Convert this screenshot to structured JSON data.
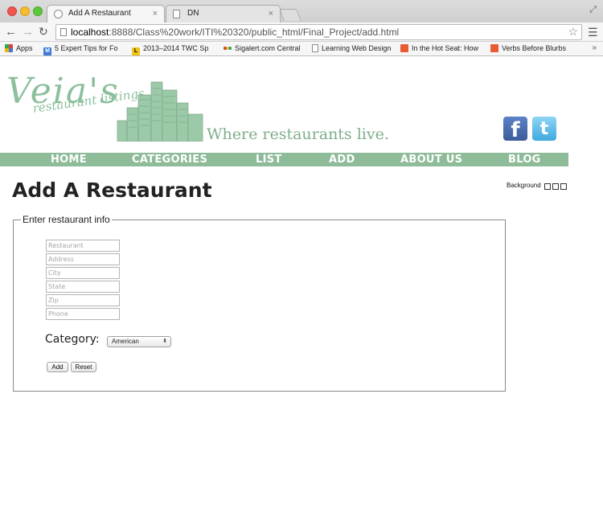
{
  "browser": {
    "tabs": [
      {
        "title": "Add A Restaurant"
      },
      {
        "title": "DN"
      }
    ],
    "close_glyph": "×",
    "url_host": "localhost",
    "url_rest": ":8888/Class%20work/ITI%20320/public_html/Final_Project/add.html",
    "bookmarks": [
      {
        "label": "Apps",
        "icon": "apps-grid-icon",
        "color": "#e04040"
      },
      {
        "label": "5 Expert Tips for Fo",
        "icon": "m-icon",
        "color": "#3d7bd6"
      },
      {
        "label": "2013–2014 TWC Sp",
        "icon": "l-icon",
        "color": "#2a2a2a"
      },
      {
        "label": "Sigalert.com Central",
        "icon": "sigalert-icon",
        "color": "#d84a2b"
      },
      {
        "label": "Learning Web Design",
        "icon": "page-icon",
        "color": "#ffffff"
      },
      {
        "label": "In the Hot Seat: How",
        "icon": "sgg-icon",
        "color": "#e85b33"
      },
      {
        "label": "Verbs Before Blurbs",
        "icon": "sgg-icon",
        "color": "#e85b33"
      }
    ],
    "bookmark_overflow": "»"
  },
  "site": {
    "logo": "Veia's",
    "logo_sub": "restaurant listings",
    "tagline": "Where restaurants live.",
    "social": {
      "facebook": "f",
      "twitter": "t"
    },
    "nav": [
      "HOME",
      "CATEGORIES",
      "LIST",
      "ADD",
      "ABOUT US",
      "BLOG"
    ],
    "accent": "#8ebb98"
  },
  "main": {
    "title": "Add A Restaurant",
    "background_label": "Background",
    "form": {
      "legend": "Enter restaurant info",
      "placeholders": [
        "Restaurant",
        "Address",
        "City",
        "State",
        "Zip",
        "Phone"
      ],
      "category_label": "Category:",
      "category_value": "American",
      "add_label": "Add",
      "reset_label": "Reset"
    }
  }
}
